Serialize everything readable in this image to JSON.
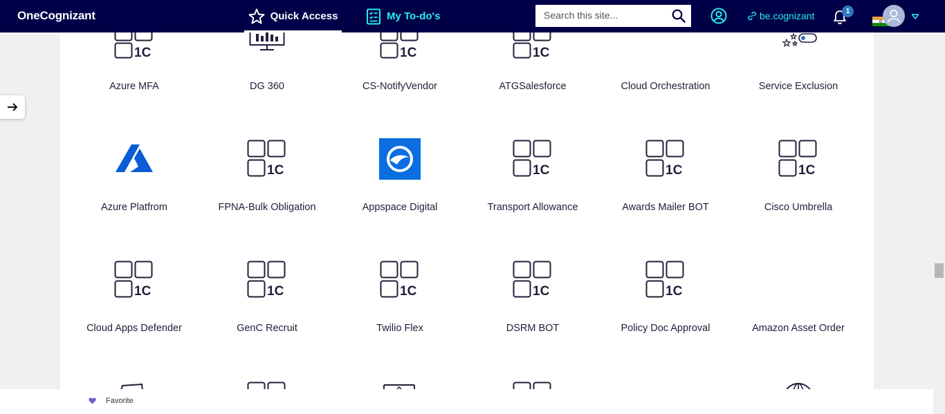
{
  "header": {
    "brand": "OneCognizant",
    "quick_access": "Quick Access",
    "my_todo": "My To-do's",
    "search_placeholder": "Search this site...",
    "be_cognizant": "be.cognizant",
    "notification_count": "1"
  },
  "tiles": [
    {
      "label": "Azure MFA",
      "icon": "app-1c-icon"
    },
    {
      "label": "DG 360",
      "icon": "monitor-icon"
    },
    {
      "label": "CS-NotifyVendor",
      "icon": "app-1c-icon"
    },
    {
      "label": "ATGSalesforce",
      "icon": "app-1c-icon"
    },
    {
      "label": "Cloud Orchestration",
      "icon": "none"
    },
    {
      "label": "Service Exclusion",
      "icon": "stars-toggle-icon"
    },
    {
      "label": "Azure Platfrom",
      "icon": "azure-logo-icon"
    },
    {
      "label": "FPNA-Bulk Obligation",
      "icon": "app-1c-icon"
    },
    {
      "label": "Appspace Digital",
      "icon": "appspace-logo-icon"
    },
    {
      "label": "Transport Allowance",
      "icon": "app-1c-icon"
    },
    {
      "label": "Awards Mailer BOT",
      "icon": "app-1c-icon"
    },
    {
      "label": "Cisco Umbrella",
      "icon": "app-1c-icon"
    },
    {
      "label": "Cloud Apps Defender",
      "icon": "app-1c-icon"
    },
    {
      "label": "GenC Recruit",
      "icon": "app-1c-icon"
    },
    {
      "label": "Twilio Flex",
      "icon": "app-1c-icon"
    },
    {
      "label": "DSRM BOT",
      "icon": "app-1c-icon"
    },
    {
      "label": "Policy Doc Approval",
      "icon": "app-1c-icon"
    },
    {
      "label": "Amazon Asset Order",
      "icon": "none"
    }
  ],
  "footer": {
    "favorite": "Favorite"
  },
  "colors": {
    "navy": "#000048",
    "teal": "#26efe9",
    "azure_blue": "#0a5bd6"
  }
}
